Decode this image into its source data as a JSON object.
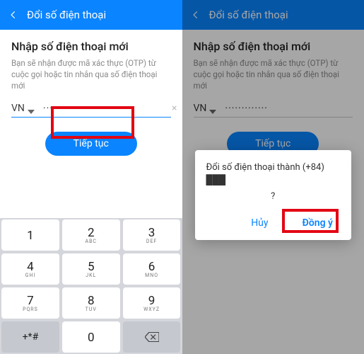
{
  "left": {
    "header_title": "Đổi số điện thoại",
    "title": "Nhập số điện thoại mới",
    "subtitle": "Bạn sẽ nhận được mã xác thực (OTP) từ cuộc gọi hoặc tin nhắn qua số điện thoại mới",
    "country": "VN",
    "phone_value": "·············",
    "continue_label": "Tiếp tục",
    "keypad": {
      "rows": [
        [
          {
            "d": "1",
            "s": ""
          },
          {
            "d": "2",
            "s": "ABC"
          },
          {
            "d": "3",
            "s": "DEF"
          }
        ],
        [
          {
            "d": "4",
            "s": "GHI"
          },
          {
            "d": "5",
            "s": "JKL"
          },
          {
            "d": "6",
            "s": "MNO"
          }
        ],
        [
          {
            "d": "7",
            "s": "PQRS"
          },
          {
            "d": "8",
            "s": "TUV"
          },
          {
            "d": "9",
            "s": "WXYZ"
          }
        ]
      ],
      "sym": "+*#",
      "zero": "0"
    }
  },
  "right": {
    "header_title": "Đổi số điện thoại",
    "title": "Nhập số điện thoại mới",
    "subtitle": "Bạn sẽ nhận được mã xác thực (OTP) từ cuộc gọi hoặc tin nhắn qua số điện thoại mới",
    "country": "VN",
    "phone_value": "·············",
    "continue_label": "Tiếp tục",
    "modal": {
      "text": "Đổi số điện thoại thành (+84) ███",
      "q": "?",
      "cancel": "Hủy",
      "ok": "Đồng ý"
    }
  }
}
